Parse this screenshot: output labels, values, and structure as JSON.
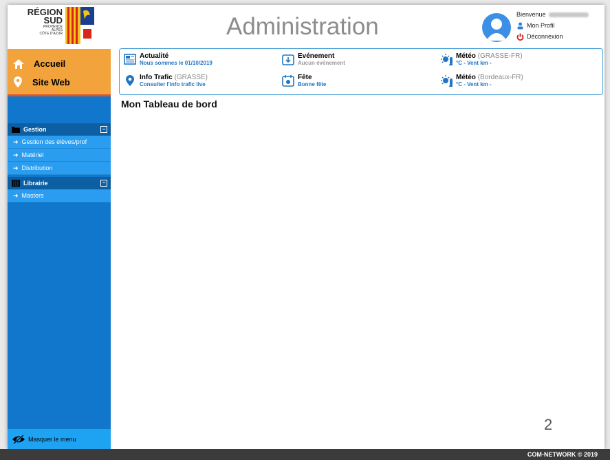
{
  "logo": {
    "line1": "RÉGION",
    "line2": "SUD",
    "line3": "PROVENCE",
    "line4": "ALPES",
    "line5": "CÔTE D'AZUR"
  },
  "header": {
    "title": "Administration"
  },
  "user": {
    "greeting": "Bienvenue",
    "profile": "Mon Profil",
    "logout": "Déconnexion"
  },
  "sidebar": {
    "home": "Accueil",
    "website": "Site Web",
    "categories": [
      {
        "label": "Gestion",
        "items": [
          "Gestion des élèves/prof",
          "Matériel",
          "Distribution"
        ]
      },
      {
        "label": "Librairie",
        "items": [
          "Masters"
        ]
      }
    ],
    "hide_menu": "Masquer le menu"
  },
  "info": {
    "news": {
      "title": "Actualité",
      "sub": "Nous sommes le 01/10/2019"
    },
    "event": {
      "title": "Evénement",
      "sub": "Aucun événement"
    },
    "weather1": {
      "title": "Météo",
      "place": "(GRASSE-FR)",
      "sub": "°C - Vent km -"
    },
    "traffic": {
      "title": "Info Trafic",
      "place": "(GRASSE)",
      "sub": "Consulter l'info trafic live"
    },
    "party": {
      "title": "Fête",
      "sub": "Bonne fête"
    },
    "weather2": {
      "title": "Météo",
      "place": "(Bordeaux-FR)",
      "sub": "°C - Vent km -"
    }
  },
  "main": {
    "title": "Mon Tableau de bord",
    "page_number": "2"
  },
  "footer": {
    "text": "COM-NETWORK © 2019"
  },
  "colors": {
    "sidebar": "#1177cc",
    "accent_orange": "#f2a33b",
    "link_blue": "#2076c4"
  }
}
